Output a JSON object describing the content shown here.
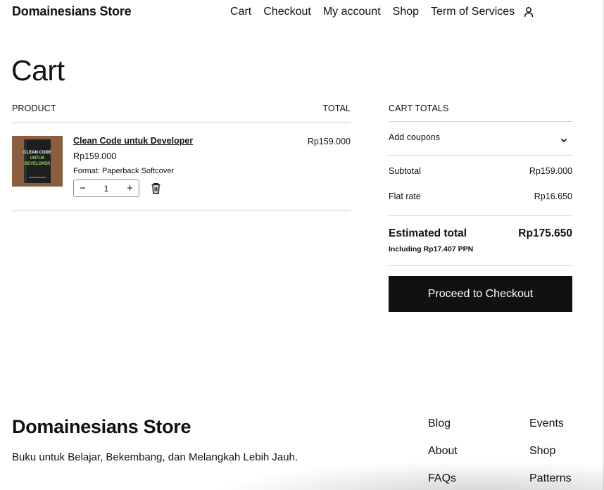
{
  "header": {
    "site_title": "Domainesians Store",
    "nav": [
      "Cart",
      "Checkout",
      "My account",
      "Shop",
      "Term of Services"
    ],
    "account_icon": "user-icon"
  },
  "page": {
    "title": "Cart"
  },
  "cart_table": {
    "product_header": "PRODUCT",
    "total_header": "TOTAL",
    "items": [
      {
        "name": "Clean Code untuk Developer",
        "price": "Rp159.000",
        "format": "Format: Paperback Softcover",
        "quantity": "1",
        "line_total": "Rp159.000",
        "cover_text": [
          "CLEAN CODE",
          "UNTUK",
          "DEVELOPER"
        ]
      }
    ]
  },
  "totals": {
    "heading": "CART TOTALS",
    "coupons_label": "Add coupons",
    "subtotal_label": "Subtotal",
    "subtotal_value": "Rp159.000",
    "shipping_label": "Flat rate",
    "shipping_value": "Rp16.650",
    "estimated_label": "Estimated total",
    "estimated_value": "Rp175.650",
    "tax_note": "Including Rp17.407 PPN",
    "checkout_button": "Proceed to Checkout"
  },
  "footer": {
    "title": "Domainesians Store",
    "tagline": "Buku untuk Belajar, Bekembang, dan Melangkah Lebih Jauh.",
    "links_col1": [
      "Blog",
      "About",
      "FAQs"
    ],
    "links_col2": [
      "Events",
      "Shop",
      "Patterns"
    ]
  },
  "colors": {
    "text": "#111111",
    "button_bg": "#111111",
    "button_text": "#ffffff",
    "rule": "#cfcfcf"
  }
}
